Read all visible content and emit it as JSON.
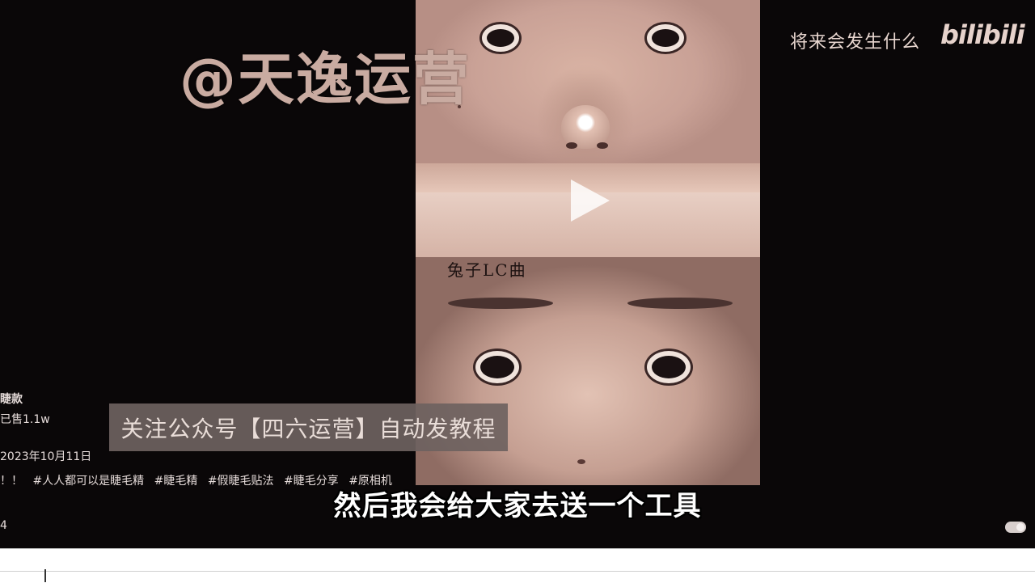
{
  "watermark": {
    "handle": "@天逸运营"
  },
  "top_right": {
    "caption": "将来会发生什么",
    "brand": "bilibili"
  },
  "video": {
    "handwritten_text": "兔子LC曲"
  },
  "notice": {
    "text": "关注公众号【四六运营】自动发教程"
  },
  "subtitle": {
    "text": "然后我会给大家去送一个工具"
  },
  "post": {
    "title": "睫款",
    "sales": "已售1.1w",
    "date": "2023年10月11日",
    "tags": [
      "！！",
      "#人人都可以是睫毛精",
      "#睫毛精",
      "#假睫毛贴法",
      "#睫毛分享",
      "#原相机"
    ],
    "count": "4"
  },
  "icons": {
    "play": "play-icon",
    "toggle": "toggle-switch"
  }
}
